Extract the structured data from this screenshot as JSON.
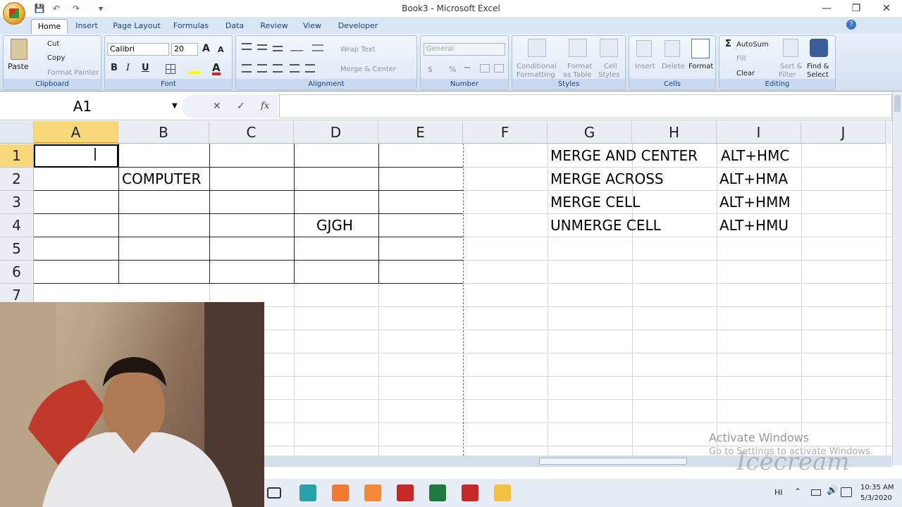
{
  "window": {
    "title": "Book3 - Microsoft Excel",
    "minimize": "—",
    "restore": "❐",
    "close": "✕"
  },
  "quick_access": {
    "save": "💾",
    "undo": "↶",
    "redo": "↷",
    "customize": "▾"
  },
  "tabs": [
    {
      "label": "Home",
      "active": true
    },
    {
      "label": "Insert"
    },
    {
      "label": "Page Layout"
    },
    {
      "label": "Formulas"
    },
    {
      "label": "Data"
    },
    {
      "label": "Review"
    },
    {
      "label": "View"
    },
    {
      "label": "Developer"
    }
  ],
  "ribbon": {
    "clipboard": {
      "label": "Clipboard",
      "paste": "Paste",
      "cut": "Cut",
      "copy": "Copy",
      "format_painter": "Format Painter"
    },
    "font": {
      "label": "Font",
      "name": "Calibri",
      "size": "20",
      "bold": "B",
      "italic": "I",
      "underline": "U"
    },
    "alignment": {
      "label": "Alignment",
      "wrap_text": "Wrap Text",
      "merge_center": "Merge & Center"
    },
    "number": {
      "label": "Number",
      "format": "General",
      "currency": "$",
      "percent": "%"
    },
    "styles": {
      "label": "Styles",
      "conditional": "Conditional",
      "conditional2": "Formatting",
      "format_table": "Format",
      "format_table2": "as Table",
      "cell_styles": "Cell",
      "cell_styles2": "Styles"
    },
    "cells": {
      "label": "Cells",
      "insert": "Insert",
      "delete": "Delete",
      "format": "Format"
    },
    "editing": {
      "label": "Editing",
      "autosum": "AutoSum",
      "fill": "Fill",
      "clear": "Clear",
      "sort": "Sort &",
      "sort2": "Filter",
      "find": "Find &",
      "find2": "Select"
    }
  },
  "formula_bar": {
    "name_box": "A1",
    "cancel": "✕",
    "enter": "✓",
    "fx": "fx",
    "value": ""
  },
  "columns": [
    "A",
    "B",
    "C",
    "D",
    "E",
    "F",
    "G",
    "H",
    "I",
    "J"
  ],
  "rows": [
    "1",
    "2",
    "3",
    "4",
    "5",
    "6",
    "7"
  ],
  "cells": {
    "B2": "COMPUTER",
    "D4": "GJGH",
    "G1": "MERGE AND CENTER",
    "I1": "ALT+HMC",
    "G2": "MERGE ACROSS",
    "I2": "ALT+HMA",
    "G3": "MERGE CELL",
    "I3": "ALT+HMM",
    "G4": "UNMERGE CELL",
    "I4": "ALT+HMU"
  },
  "watermark": {
    "line1": "Activate Windows",
    "line2": "Go to Settings to activate Windows.",
    "brand": "Icecream"
  },
  "taskbar": {
    "lang": "HI",
    "time": "10:35 AM",
    "date": "5/3/2020"
  }
}
